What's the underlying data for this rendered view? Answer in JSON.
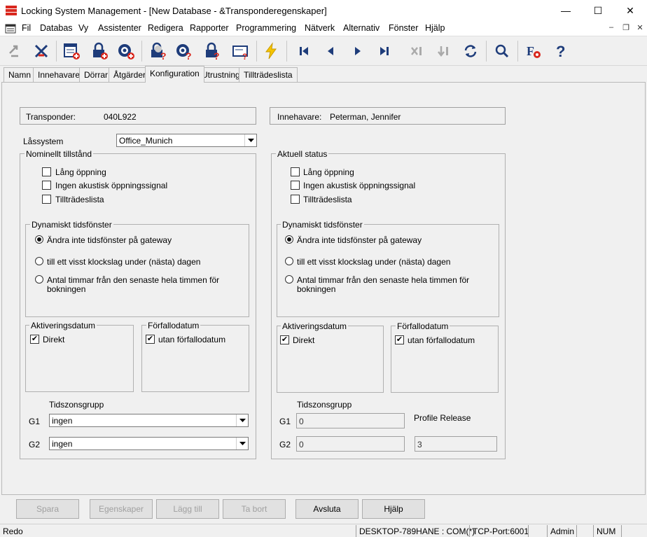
{
  "window": {
    "title": "Locking System Management - [New Database - &Transponderegenskaper]",
    "minimize_glyph": "—",
    "maximize_glyph": "☐",
    "close_glyph": "✕"
  },
  "menu": [
    "Fil",
    "Databas",
    "Vy",
    "Assistenter",
    "Redigera",
    "Rapporter",
    "Programmering",
    "Nätverk",
    "Alternativ",
    "Fönster",
    "Hjälp"
  ],
  "mdi_controls": [
    "–",
    "❐",
    "✕"
  ],
  "toolbar": {
    "icons": [
      "sync-disabled-icon",
      "delete-transponder-icon",
      "new-door-icon",
      "new-lock-icon",
      "new-transponder-icon",
      "lock-status-icon",
      "transponder-status-icon",
      "lock-query-icon",
      "card-reader-icon",
      "program-icon",
      "first-record-icon",
      "prev-record-icon",
      "next-record-icon",
      "last-record-icon",
      "delete-record-icon",
      "sort-icon",
      "refresh-icon",
      "search-icon",
      "font-settings-icon",
      "help-icon"
    ]
  },
  "tabs": [
    "Namn",
    "Innehavare",
    "Dörrar",
    "Åtgärder",
    "Konfiguration",
    "Utrustning",
    "Tillträdeslista"
  ],
  "active_tab": "Konfiguration",
  "transponder": {
    "label": "Transponder:",
    "value": "040L922"
  },
  "holder": {
    "label": "Innehavare:",
    "value": "Peterman, Jennifer"
  },
  "locking_system": {
    "label": "Låssystem",
    "value": "Office_Munich"
  },
  "nominal": {
    "title": "Nominellt tillstånd",
    "options": [
      {
        "label": "Lång öppning",
        "checked": false
      },
      {
        "label": "Ingen akustisk öppningssignal",
        "checked": false
      },
      {
        "label": "Tillträdeslista",
        "checked": false
      }
    ],
    "dyn_title": "Dynamiskt tidsfönster",
    "radio1": "Ändra inte tidsfönster på gateway",
    "radio2": "till ett visst klockslag under (nästa) dagen",
    "radio3a": "Antal timmar från den senaste hela timmen för",
    "radio3b": "bokningen",
    "selected_radio": 1,
    "activation_title": "Aktiveringsdatum",
    "activation_label": "Direkt",
    "activation_checked": true,
    "expiry_title": "Förfallodatum",
    "expiry_label": "utan förfallodatum",
    "expiry_checked": true,
    "tz_title": "Tidszonsgrupp",
    "g1_label": "G1",
    "g1_value": "ingen",
    "g2_label": "G2",
    "g2_value": "ingen"
  },
  "current": {
    "title": "Aktuell status",
    "options": [
      {
        "label": "Lång öppning",
        "checked": false
      },
      {
        "label": "Ingen akustisk öppningssignal",
        "checked": false
      },
      {
        "label": "Tillträdeslista",
        "checked": false
      }
    ],
    "dyn_title": "Dynamiskt tidsfönster",
    "radio1": "Ändra inte tidsfönster på gateway",
    "radio2": "till ett visst klockslag under (nästa) dagen",
    "radio3a": "Antal timmar från den senaste hela timmen för",
    "radio3b": "bokningen",
    "selected_radio": 1,
    "activation_title": "Aktiveringsdatum",
    "activation_label": "Direkt",
    "activation_checked": true,
    "expiry_title": "Förfallodatum",
    "expiry_label": "utan förfallodatum",
    "expiry_checked": true,
    "tz_title": "Tidszonsgrupp",
    "g1_label": "G1",
    "g1_value": "0",
    "g2_label": "G2",
    "g2_value": "0",
    "profile_label": "Profile Release",
    "profile_value": "3"
  },
  "buttons": {
    "save": "Spara",
    "properties": "Egenskaper",
    "add": "Lägg till",
    "remove": "Ta bort",
    "close": "Avsluta",
    "help": "Hjälp"
  },
  "status": {
    "ready": "Redo",
    "connection": "DESKTOP-789HANE : COM(*)",
    "port": "TCP-Port:6001",
    "user": "Admin",
    "num": "NUM"
  }
}
